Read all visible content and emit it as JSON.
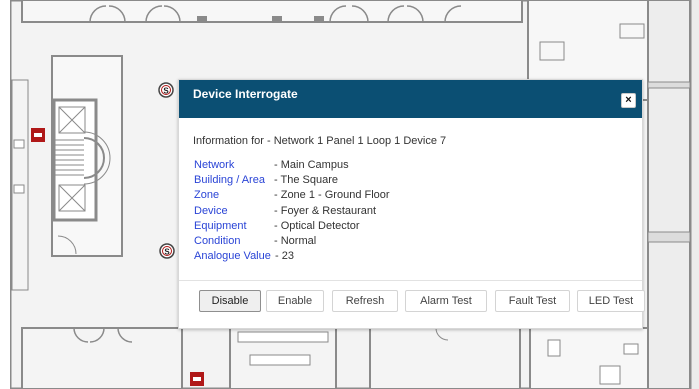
{
  "dialog": {
    "title": "Device Interrogate",
    "close_label": "×",
    "info_prefix": "Information for - ",
    "info_target": "Network 1 Panel 1 Loop 1 Device 7",
    "fields": [
      {
        "label": "Network",
        "value": "- Main Campus"
      },
      {
        "label": "Building / Area",
        "value": "- The Square"
      },
      {
        "label": "Zone",
        "value": "- Zone 1 - Ground Floor"
      },
      {
        "label": "Device",
        "value": "- Foyer & Restaurant"
      },
      {
        "label": "Equipment",
        "value": "- Optical Detector"
      },
      {
        "label": "Condition",
        "value": "- Normal"
      },
      {
        "label": "Analogue Value",
        "value": "- 23"
      }
    ],
    "buttons": {
      "disable": "Disable",
      "enable": "Enable",
      "refresh": "Refresh",
      "alarm_test": "Alarm Test",
      "fault_test": "Fault Test",
      "led_test": "LED Test"
    }
  },
  "floorplan": {
    "sensor_glyph": "S"
  },
  "colors": {
    "header": "#0b4f73",
    "label_link": "#2a44d6",
    "wall": "#8a8a8a",
    "floor": "#f2f2f2",
    "fire_panel": "#b01818"
  }
}
